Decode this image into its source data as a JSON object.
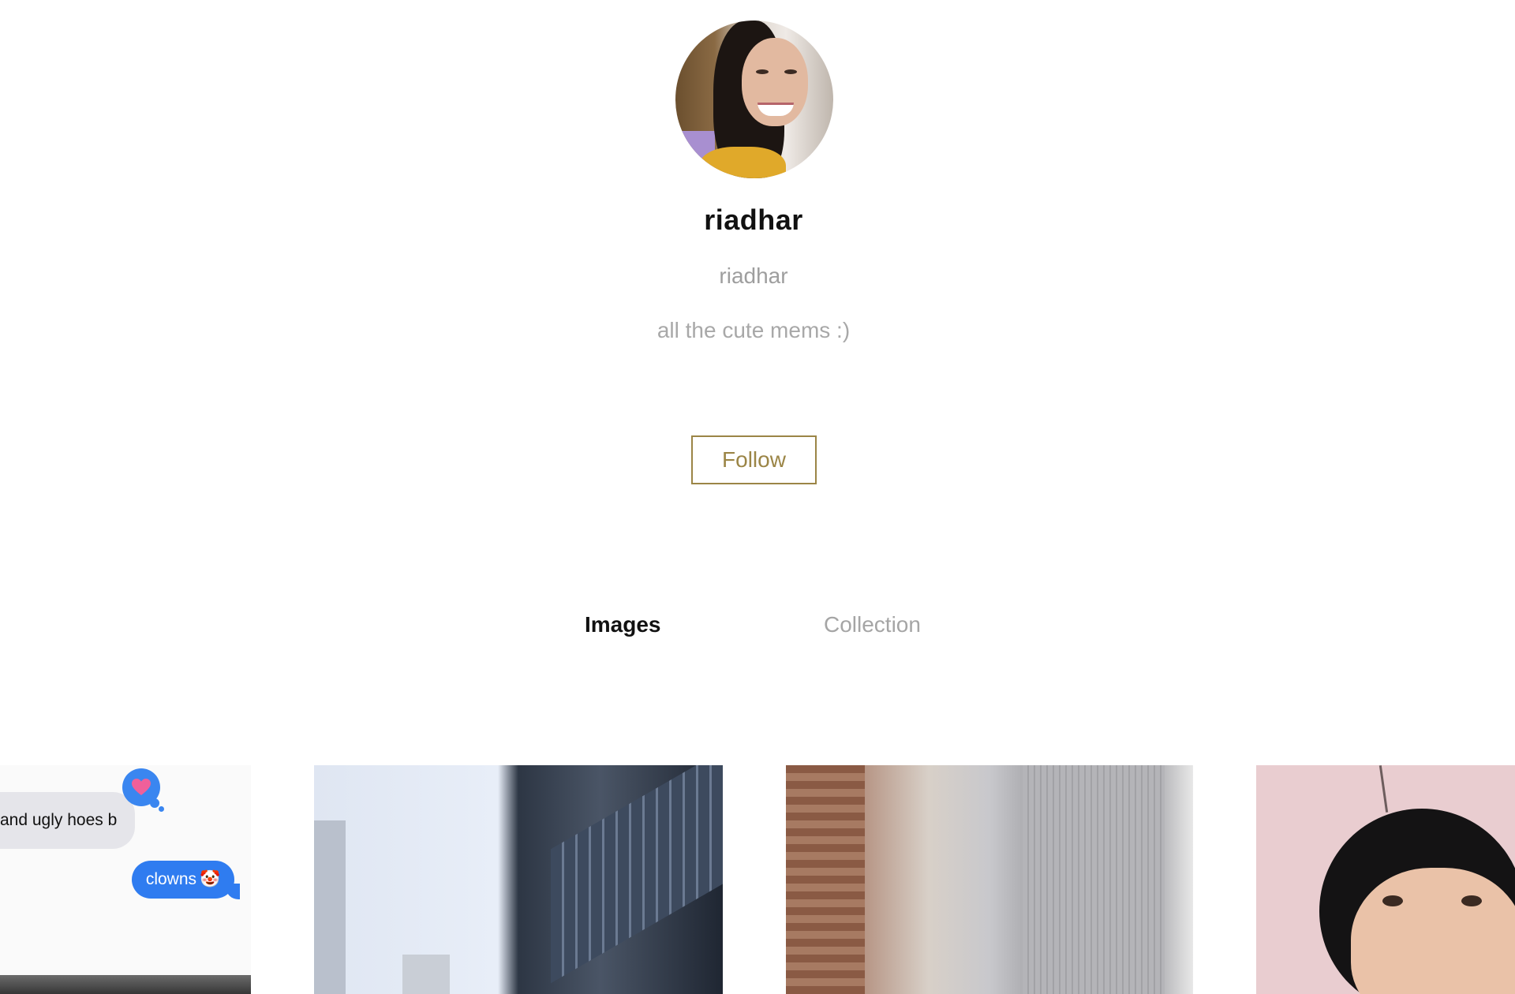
{
  "profile": {
    "display_name": "riadhar",
    "username": "riadhar",
    "bio": "all the cute mems :)",
    "follow_label": "Follow"
  },
  "tabs": [
    {
      "label": "Images",
      "active": true
    },
    {
      "label": "Collection",
      "active": false
    }
  ],
  "grid": {
    "tile1": {
      "grey_bubble_text": "and ugly hoes b",
      "blue_bubble_text": "clowns",
      "blue_bubble_emoji": "🤡",
      "tapback_emoji": "♥"
    }
  },
  "colors": {
    "accent": "#9b8546",
    "imessage_blue": "#2f7cf0",
    "muted_text": "#a8a8a8"
  }
}
